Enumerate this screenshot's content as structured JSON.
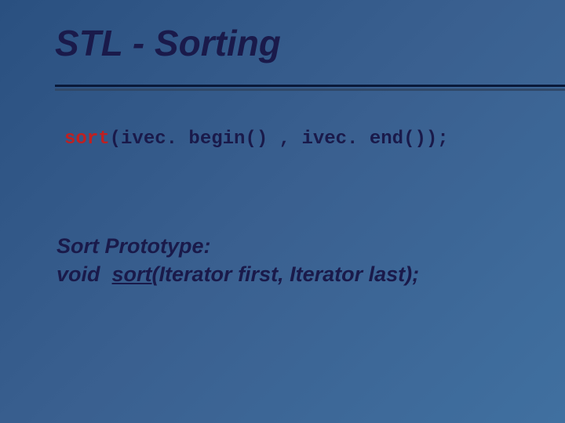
{
  "title": "STL - Sorting",
  "code": {
    "kw": "sort",
    "rest": "(ivec. begin() , ivec. end());"
  },
  "proto": {
    "line1": "Sort Prototype:",
    "void": "void",
    "sort_kw": "sort",
    "sig": "(Iterator first, Iterator  last);"
  }
}
